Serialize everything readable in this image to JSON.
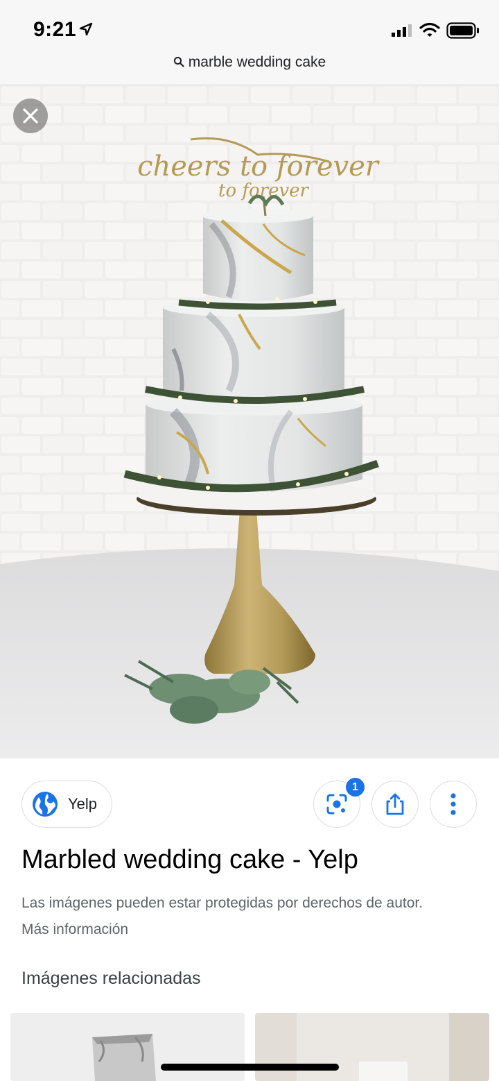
{
  "status_bar": {
    "time": "9:21",
    "icons": [
      "location-arrow-icon",
      "cellular-signal-icon",
      "wifi-icon",
      "battery-icon"
    ]
  },
  "search": {
    "query": "marble wedding cake",
    "icon": "search-icon"
  },
  "image": {
    "topper_text": "cheers to forever",
    "close_icon": "close-icon"
  },
  "source": {
    "label": "Yelp",
    "icon": "globe-icon"
  },
  "actions": {
    "lens_badge": "1",
    "icons": [
      "lens-icon",
      "share-icon",
      "more-vert-icon"
    ]
  },
  "result": {
    "title": "Marbled wedding cake - Yelp",
    "copyright_notice": "Las imágenes pueden estar protegidas por derechos de autor.",
    "more_info_link": "Más información"
  },
  "related": {
    "heading": "Imágenes relacionadas"
  },
  "colors": {
    "accent_blue": "#1a73e8",
    "text_primary": "#202124",
    "text_secondary": "#5f6368",
    "border": "#dadce0",
    "gold": "#b49a55"
  }
}
